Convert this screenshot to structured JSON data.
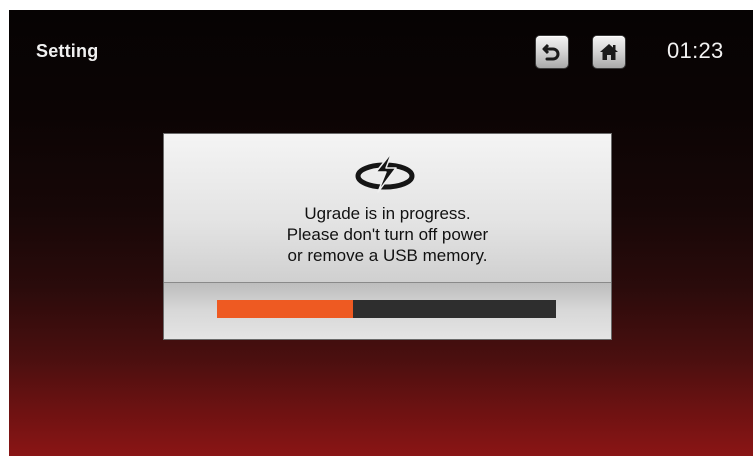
{
  "header": {
    "title": "Setting",
    "clock": "01:23"
  },
  "icons": {
    "back": "back-arrow-icon",
    "home": "home-icon",
    "update": "update-sync-icon"
  },
  "dialog": {
    "line1": "Ugrade is in progress.",
    "line2": "Please don't turn off  power",
    "line3": "or remove a USB memory.",
    "progress": 0.4
  },
  "colors": {
    "progress_fill": "#ee5a22",
    "progress_track": "#2e2e2e"
  }
}
